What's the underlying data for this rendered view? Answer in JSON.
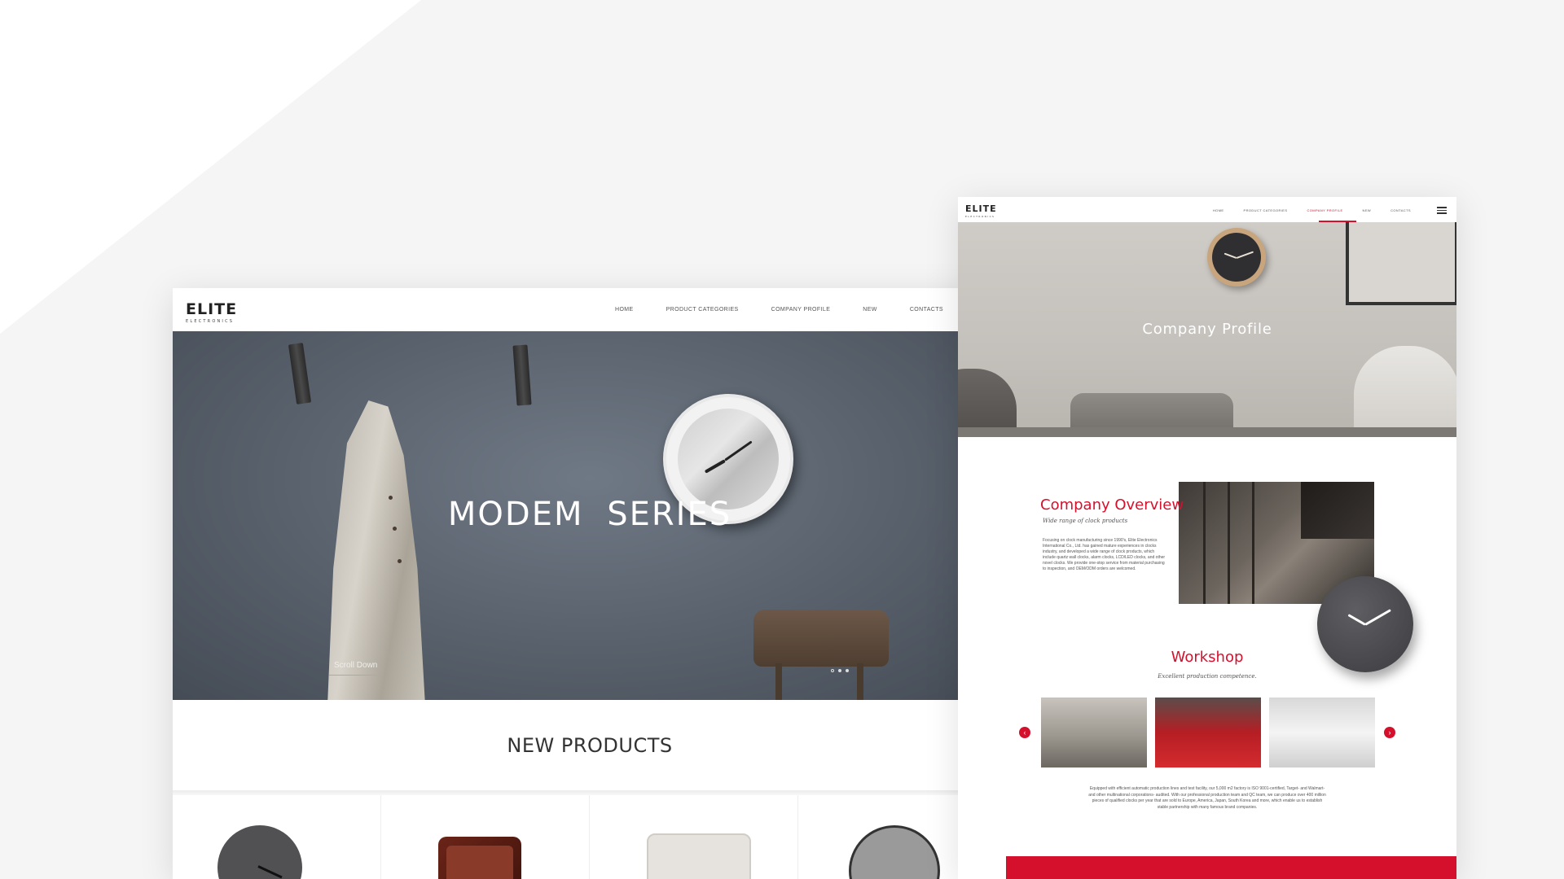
{
  "colors": {
    "accent_red": "#d5102d",
    "background": "#f5f5f5"
  },
  "left_page": {
    "logo": {
      "main": "ELITE",
      "sub": "ELECTRONICS"
    },
    "nav": [
      "HOME",
      "PRODUCT CATEGORIES",
      "COMPANY PROFILE",
      "NEW",
      "CONTACTS"
    ],
    "menu_icon": "hamburger-icon",
    "hero_title": "MODEM  SERIES",
    "scroll_label": "Scroll Down",
    "new_products_title": "NEW PRODUCTS"
  },
  "right_page": {
    "logo": {
      "main": "ELITE",
      "sub": "ELECTRONICS"
    },
    "nav": [
      "HOME",
      "PRODUCT CATEGORIES",
      "COMPANY PROFILE",
      "NEW",
      "CONTACTS"
    ],
    "active_nav": "COMPANY PROFILE",
    "menu_icon": "hamburger-icon",
    "hero_title": "Company Profile",
    "overview": {
      "title": "Company Overview",
      "subtitle": "Wide range of clock products",
      "text": "Focusing on clock manufacturing since 1990's, Elite Electronics International Co., Ltd. has gained mature experiences in clocks industry, and developed a wide range of clock products, which include quartz wall clocks, alarm clocks, LCD/LED clocks, and other novel clocks. We provide one-stop service from material purchasing to inspection, and OEM/ODM orders are welcomed."
    },
    "workshop": {
      "title": "Workshop",
      "subtitle": "Excellent production competence.",
      "prev_icon": "chevron-left-icon",
      "next_icon": "chevron-right-icon",
      "prev_glyph": "‹",
      "next_glyph": "›",
      "text": "Equipped with efficient automatic production lines and test facility, our 5,000 m2 factory is ISO 9001-certified, Target- and Walmart- and other multinational corporations- audited. With our professional production team and QC team, we can produce over 400 million pieces of qualified clocks per year that are sold to Europe, America, Japan, South Korea and more, which enable us to establish stable partnership with many famous brand companies."
    }
  }
}
